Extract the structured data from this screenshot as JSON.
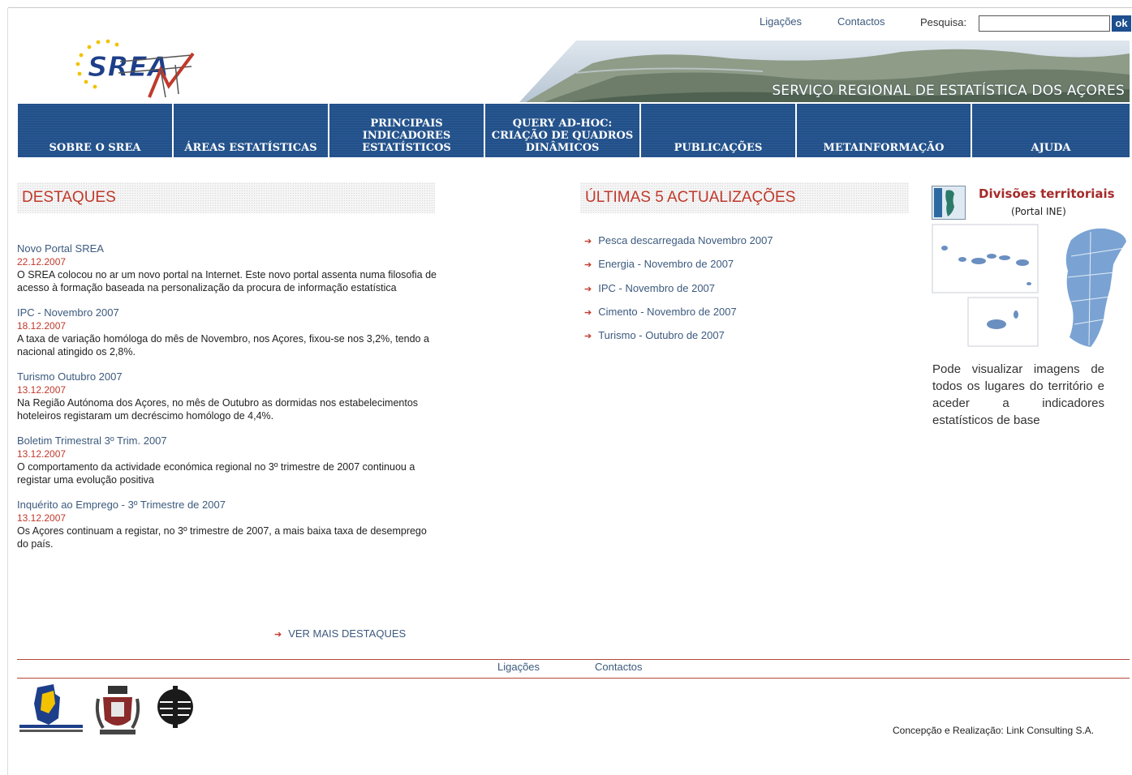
{
  "header": {
    "links": [
      "Ligações",
      "Contactos"
    ],
    "search_label": "Pesquisa:",
    "search_value": "",
    "search_button": "ok",
    "logo_text": "SREA",
    "banner_title": "SERVIÇO REGIONAL DE ESTATÍSTICA DOS AÇORES"
  },
  "nav": {
    "items": [
      {
        "label": "SOBRE O SREA"
      },
      {
        "label": "ÁREAS ESTATÍSTICAS"
      },
      {
        "label": "PRINCIPAIS\nINDICADORES\nESTATÍSTICOS"
      },
      {
        "label": "QUERY AD-HOC:\nCRIAÇÃO DE QUADROS\nDINÂMICOS"
      },
      {
        "label": "PUBLICAÇÕES"
      },
      {
        "label": "METAINFORMAÇÃO"
      },
      {
        "label": "AJUDA"
      }
    ]
  },
  "destaques": {
    "title": "DESTAQUES",
    "items": [
      {
        "title": "Novo Portal SREA",
        "date": "22.12.2007",
        "text": "O SREA colocou no ar um novo portal na Internet. Este novo portal assenta numa filosofia de acesso à formação baseada na personalização da procura de informação estatística"
      },
      {
        "title": "IPC - Novembro 2007",
        "date": "18.12.2007",
        "text": "A taxa de variação homóloga do mês de Novembro, nos Açores, fixou-se nos 3,2%, tendo a nacional atingido os 2,8%."
      },
      {
        "title": "Turismo Outubro 2007",
        "date": "13.12.2007",
        "text": "Na Região Autónoma dos Açores, no mês de Outubro as dormidas nos estabelecimentos hoteleiros registaram um decréscimo homólogo de 4,4%."
      },
      {
        "title": "Boletim Trimestral 3º Trim. 2007",
        "date": "13.12.2007",
        "text": "O comportamento da actividade económica regional no 3º trimestre de 2007 continuou a registar uma evolução positiva"
      },
      {
        "title": "Inquérito ao Emprego - 3º Trimestre de 2007",
        "date": "13.12.2007",
        "text": "Os Açores continuam a registar, no 3º trimestre de 2007, a mais baixa taxa de desemprego do país."
      }
    ],
    "more": "VER MAIS DESTAQUES"
  },
  "updates": {
    "title": "ÚLTIMAS 5 ACTUALIZAÇÕES",
    "items": [
      "Pesca descarregada Novembro 2007",
      "Energia - Novembro de 2007",
      "IPC - Novembro de 2007",
      "Cimento - Novembro de 2007",
      "Turismo - Outubro de 2007"
    ]
  },
  "territory": {
    "title": "Divisões territoriais",
    "subtitle": "(Portal INE)",
    "text": "Pode visualizar imagens de todos os lugares do território e aceder a indicadores estatísticos de base"
  },
  "footer": {
    "links": [
      "Ligações",
      "Contactos"
    ],
    "credits": "Concepção e Realização: Link Consulting S.A."
  },
  "colors": {
    "nav_blue": "#21508a",
    "heading_red": "#c0392b",
    "link_blue": "#3c5a7e"
  }
}
